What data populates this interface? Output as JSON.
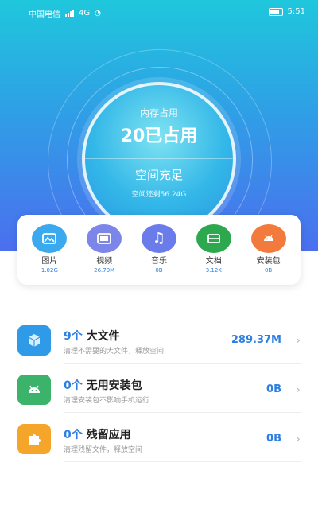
{
  "status_bar": {
    "carrier": "中国电信",
    "network": "4G",
    "time": "5:51"
  },
  "storage": {
    "label": "内存占用",
    "used": "20已占用",
    "status": "空间充足",
    "remaining": "空间还剩56.24G"
  },
  "categories": [
    {
      "name": "图片",
      "size": "1.02G",
      "icon": "photo-icon",
      "color": "#3aa9ee"
    },
    {
      "name": "视频",
      "size": "26.79M",
      "icon": "video-icon",
      "color": "#7b86e8"
    },
    {
      "name": "音乐",
      "size": "0B",
      "icon": "music-icon",
      "color": "#6a7bea"
    },
    {
      "name": "文档",
      "size": "3.12K",
      "icon": "document-icon",
      "color": "#2ea84f"
    },
    {
      "name": "安装包",
      "size": "0B",
      "icon": "android-icon",
      "color": "#f27a3c"
    }
  ],
  "cleanup": [
    {
      "count": "9个",
      "title": "大文件",
      "desc": "清理不需要的大文件，释放空间",
      "size": "289.37M",
      "icon": "box-icon",
      "color": "#2f9be8"
    },
    {
      "count": "0个",
      "title": "无用安装包",
      "desc": "清理安装包不影响手机运行",
      "size": "0B",
      "icon": "android-icon",
      "color": "#3bb36a"
    },
    {
      "count": "0个",
      "title": "残留应用",
      "desc": "清理残留文件，释放空间",
      "size": "0B",
      "icon": "puzzle-icon",
      "color": "#f5a52a"
    }
  ]
}
